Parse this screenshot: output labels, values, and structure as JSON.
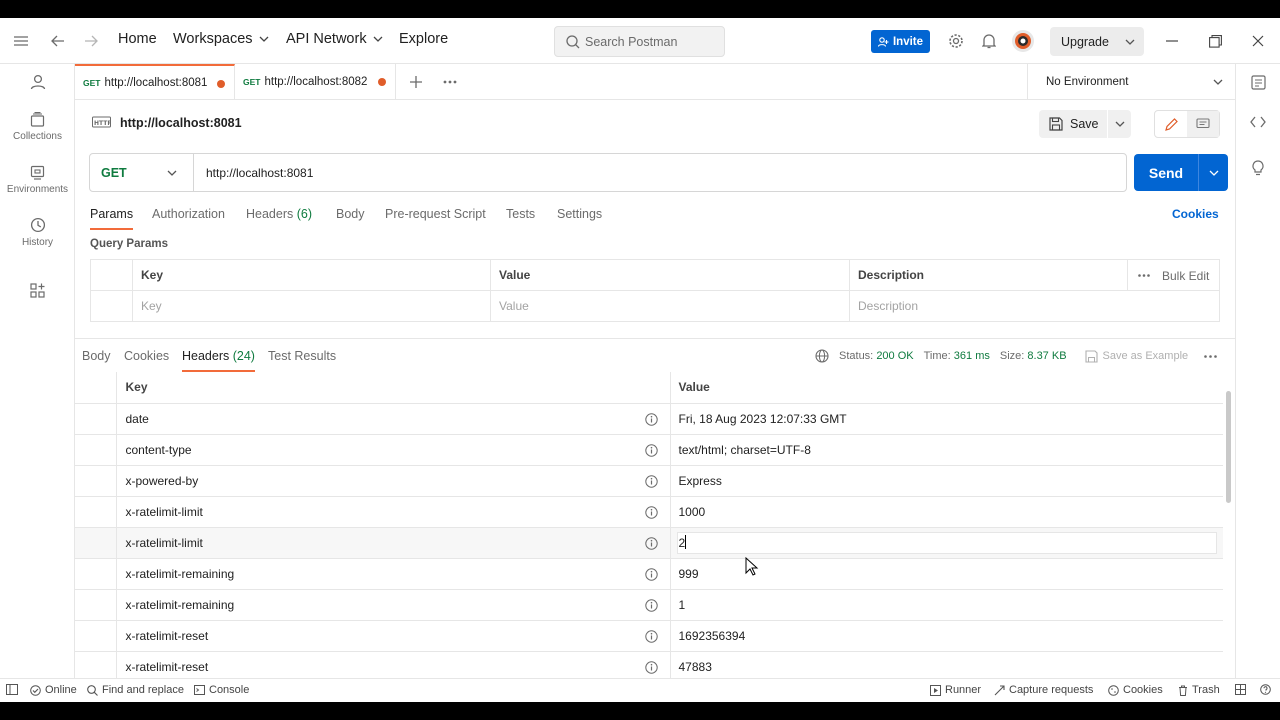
{
  "topbar": {
    "nav": [
      "Home",
      "Workspaces",
      "API Network",
      "Explore"
    ],
    "search_placeholder": "Search Postman",
    "invite_label": "Invite",
    "upgrade_label": "Upgrade"
  },
  "sidebar": {
    "items": [
      {
        "label": "Collections"
      },
      {
        "label": "Environments"
      },
      {
        "label": "History"
      }
    ]
  },
  "tabs": [
    {
      "method": "GET",
      "url": "http://localhost:8081",
      "active": true
    },
    {
      "method": "GET",
      "url": "http://localhost:8082",
      "active": false
    }
  ],
  "environment": {
    "selected": "No Environment"
  },
  "request": {
    "title": "http://localhost:8081",
    "save_label": "Save",
    "method": "GET",
    "url": "http://localhost:8081",
    "send_label": "Send",
    "tabs": [
      {
        "label": "Params",
        "count": ""
      },
      {
        "label": "Authorization",
        "count": ""
      },
      {
        "label": "Headers",
        "count": "(6)"
      },
      {
        "label": "Body",
        "count": ""
      },
      {
        "label": "Pre-request Script",
        "count": ""
      },
      {
        "label": "Tests",
        "count": ""
      },
      {
        "label": "Settings",
        "count": ""
      }
    ],
    "cookies_link": "Cookies",
    "query_params_label": "Query Params",
    "params_table": {
      "headers": [
        "Key",
        "Value",
        "Description"
      ],
      "bulk_edit": "Bulk Edit",
      "placeholders": [
        "Key",
        "Value",
        "Description"
      ]
    }
  },
  "response": {
    "tabs": [
      {
        "label": "Body",
        "count": ""
      },
      {
        "label": "Cookies",
        "count": ""
      },
      {
        "label": "Headers",
        "count": "(24)"
      },
      {
        "label": "Test Results",
        "count": ""
      }
    ],
    "status_label": "Status:",
    "status_value": "200 OK",
    "time_label": "Time:",
    "time_value": "361 ms",
    "size_label": "Size:",
    "size_value": "8.37 KB",
    "save_example": "Save as Example",
    "headers_table": {
      "columns": [
        "Key",
        "Value"
      ],
      "rows": [
        {
          "key": "date",
          "value": "Fri, 18 Aug 2023 12:07:33 GMT"
        },
        {
          "key": "content-type",
          "value": "text/html; charset=UTF-8"
        },
        {
          "key": "x-powered-by",
          "value": "Express"
        },
        {
          "key": "x-ratelimit-limit",
          "value": "1000"
        },
        {
          "key": "x-ratelimit-limit",
          "value": "2"
        },
        {
          "key": "x-ratelimit-remaining",
          "value": "999"
        },
        {
          "key": "x-ratelimit-remaining",
          "value": "1"
        },
        {
          "key": "x-ratelimit-reset",
          "value": "1692356394"
        },
        {
          "key": "x-ratelimit-reset",
          "value": "47883"
        }
      ]
    }
  },
  "statusbar": {
    "online": "Online",
    "find_replace": "Find and replace",
    "console": "Console",
    "runner": "Runner",
    "capture": "Capture requests",
    "cookies": "Cookies",
    "trash": "Trash"
  },
  "colors": {
    "accent": "#f26b3a",
    "primary": "#0265d2",
    "get_method": "#0f7b3f"
  }
}
